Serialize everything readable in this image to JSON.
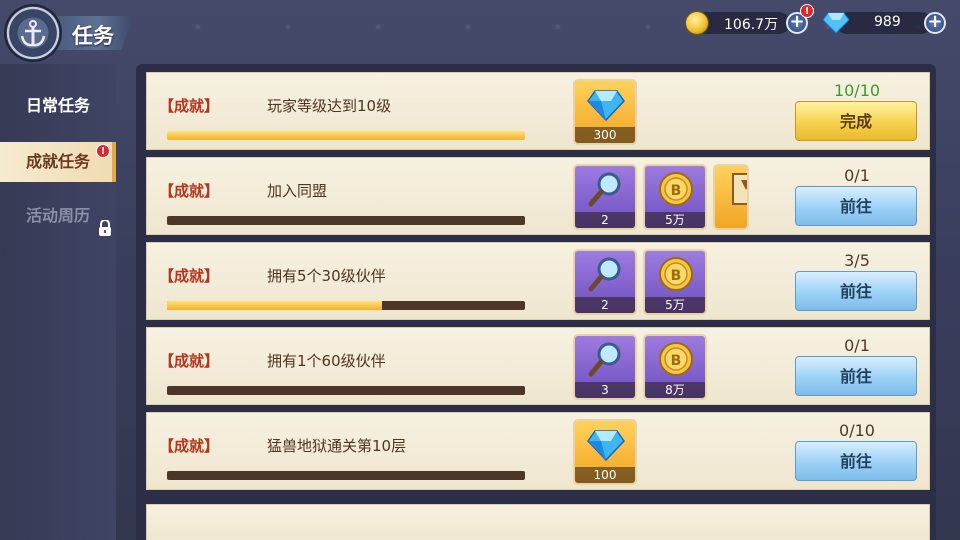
{
  "header": {
    "title": "任务"
  },
  "currency": {
    "coins": {
      "value": "106.7万",
      "icon": "gold-coin-icon"
    },
    "gems": {
      "value": "989",
      "icon": "diamond-icon"
    },
    "alert_mark": "!"
  },
  "sidebar": {
    "items": [
      {
        "label": "日常任务",
        "state": "normal"
      },
      {
        "label": "成就任务",
        "state": "active"
      },
      {
        "label": "活动周历",
        "state": "locked"
      }
    ],
    "alert_mark": "!"
  },
  "tasks": [
    {
      "tag": "【成就】",
      "name": "玩家等级达到10级",
      "progress": 1.0,
      "count": "10/10",
      "button": "完成",
      "done": true,
      "rewards": [
        {
          "type": "diamond",
          "count": "300"
        }
      ]
    },
    {
      "tag": "【成就】",
      "name": "加入同盟",
      "progress": 0.0,
      "count": "0/1",
      "button": "前往",
      "done": false,
      "rewards": [
        {
          "type": "magnifier",
          "count": "2"
        },
        {
          "type": "coin",
          "count": "5万"
        },
        {
          "type": "scroll",
          "count": ""
        }
      ]
    },
    {
      "tag": "【成就】",
      "name": "拥有5个30级伙伴",
      "progress": 0.6,
      "count": "3/5",
      "button": "前往",
      "done": false,
      "rewards": [
        {
          "type": "magnifier",
          "count": "2"
        },
        {
          "type": "coin",
          "count": "5万"
        }
      ]
    },
    {
      "tag": "【成就】",
      "name": "拥有1个60级伙伴",
      "progress": 0.0,
      "count": "0/1",
      "button": "前往",
      "done": false,
      "rewards": [
        {
          "type": "magnifier",
          "count": "3"
        },
        {
          "type": "coin",
          "count": "8万"
        }
      ]
    },
    {
      "tag": "【成就】",
      "name": "猛兽地狱通关第10层",
      "progress": 0.0,
      "count": "0/10",
      "button": "前往",
      "done": false,
      "rewards": [
        {
          "type": "diamond",
          "count": "100"
        }
      ]
    }
  ],
  "colors": {
    "accent_gold": "#f3b22e",
    "tag_red": "#b4361d",
    "done_green": "#3d9a2c",
    "button_blue": "#9bd2f6"
  }
}
